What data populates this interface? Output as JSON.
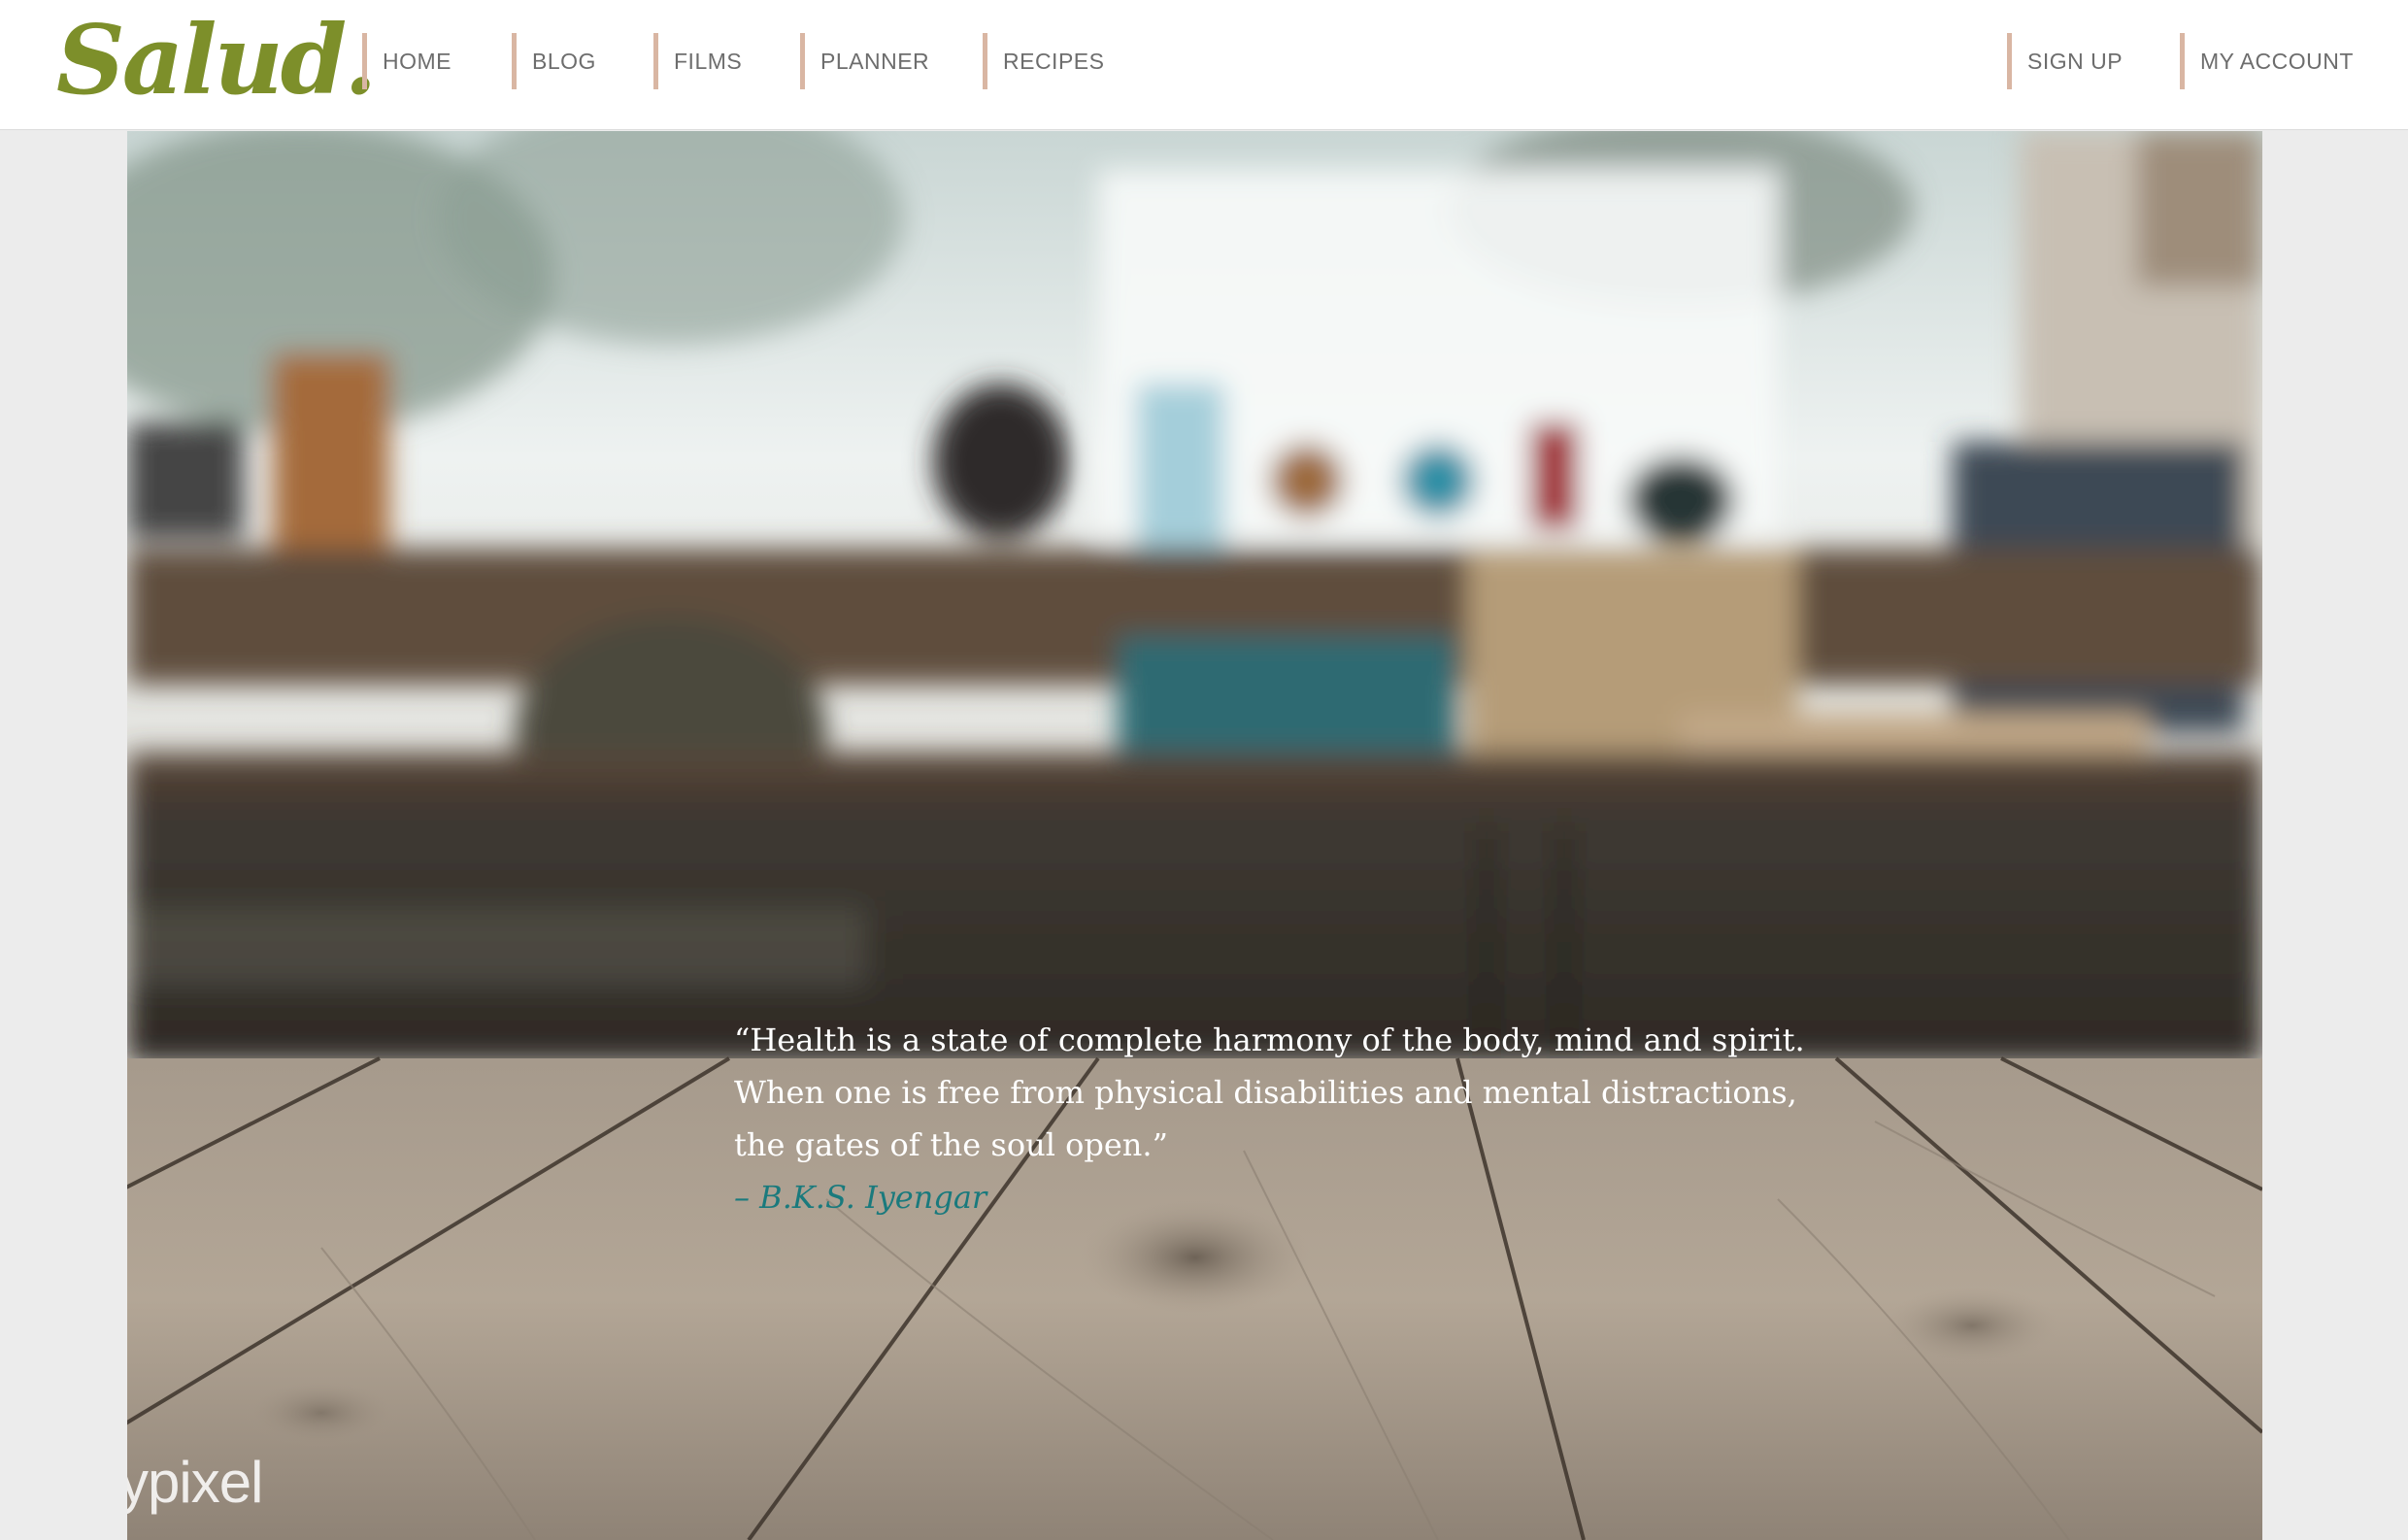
{
  "brand": {
    "logo_text": "Salud.",
    "color": "#7d8f2a"
  },
  "nav": {
    "left": [
      {
        "label": "HOME"
      },
      {
        "label": "BLOG"
      },
      {
        "label": "FILMS"
      },
      {
        "label": "PLANNER"
      },
      {
        "label": "RECIPES"
      }
    ],
    "right": [
      {
        "label": "SIGN UP"
      },
      {
        "label": "MY ACCOUNT"
      }
    ],
    "divider_color": "#d9b6a3"
  },
  "hero": {
    "quote_lines": [
      "“Health is a state of complete harmony of the body, mind and spirit.",
      "When one is free from physical disabilities and mental distractions,",
      "the gates of the soul open.”"
    ],
    "author": "– B.K.S. Iyengar",
    "author_color": "#1a7a7d",
    "watermark": "ypixel"
  }
}
